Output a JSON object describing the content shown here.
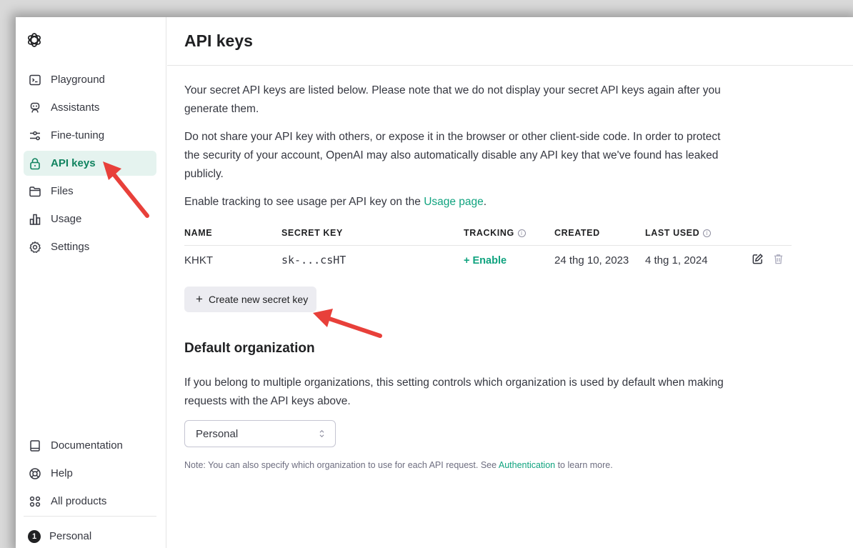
{
  "sidebar": {
    "logo": "openai-logo-icon",
    "nav": [
      {
        "label": "Playground",
        "icon": "terminal-icon"
      },
      {
        "label": "Assistants",
        "icon": "robot-icon"
      },
      {
        "label": "Fine-tuning",
        "icon": "sliders-icon"
      },
      {
        "label": "API keys",
        "icon": "lock-icon",
        "active": true
      },
      {
        "label": "Files",
        "icon": "folder-icon"
      },
      {
        "label": "Usage",
        "icon": "bar-chart-icon"
      },
      {
        "label": "Settings",
        "icon": "gear-icon"
      }
    ],
    "bottom": [
      {
        "label": "Documentation",
        "icon": "book-icon"
      },
      {
        "label": "Help",
        "icon": "lifebuoy-icon"
      },
      {
        "label": "All products",
        "icon": "grid-icon"
      }
    ],
    "account": {
      "badge": "1",
      "label": "Personal"
    }
  },
  "header": {
    "title": "API keys"
  },
  "intro": {
    "p1": "Your secret API keys are listed below. Please note that we do not display your secret API keys again after you generate them.",
    "p2": "Do not share your API key with others, or expose it in the browser or other client-side code. In order to protect the security of your account, OpenAI may also automatically disable any API key that we've found has leaked publicly.",
    "p3_prefix": "Enable tracking to see usage per API key on the ",
    "p3_link": "Usage page",
    "p3_suffix": "."
  },
  "table": {
    "columns": [
      "NAME",
      "SECRET KEY",
      "TRACKING",
      "CREATED",
      "LAST USED"
    ],
    "info_glyph": "i",
    "rows": [
      {
        "name": "KHKT",
        "secret_key": "sk-...csHT",
        "tracking": "+ Enable",
        "created": "24 thg 10, 2023",
        "last_used": "4 thg 1, 2024"
      }
    ]
  },
  "create_button": {
    "plus": "+",
    "label": "Create new secret key"
  },
  "default_org": {
    "title": "Default organization",
    "description": "If you belong to multiple organizations, this setting controls which organization is used by default when making requests with the API keys above.",
    "selected": "Personal",
    "note_prefix": "Note: You can also specify which organization to use for each API request. See ",
    "note_link": "Authentication",
    "note_suffix": " to learn more."
  },
  "colors": {
    "accent": "#10a37f",
    "active_bg": "#e5f3ef",
    "annotation_arrow": "#e8403a"
  }
}
